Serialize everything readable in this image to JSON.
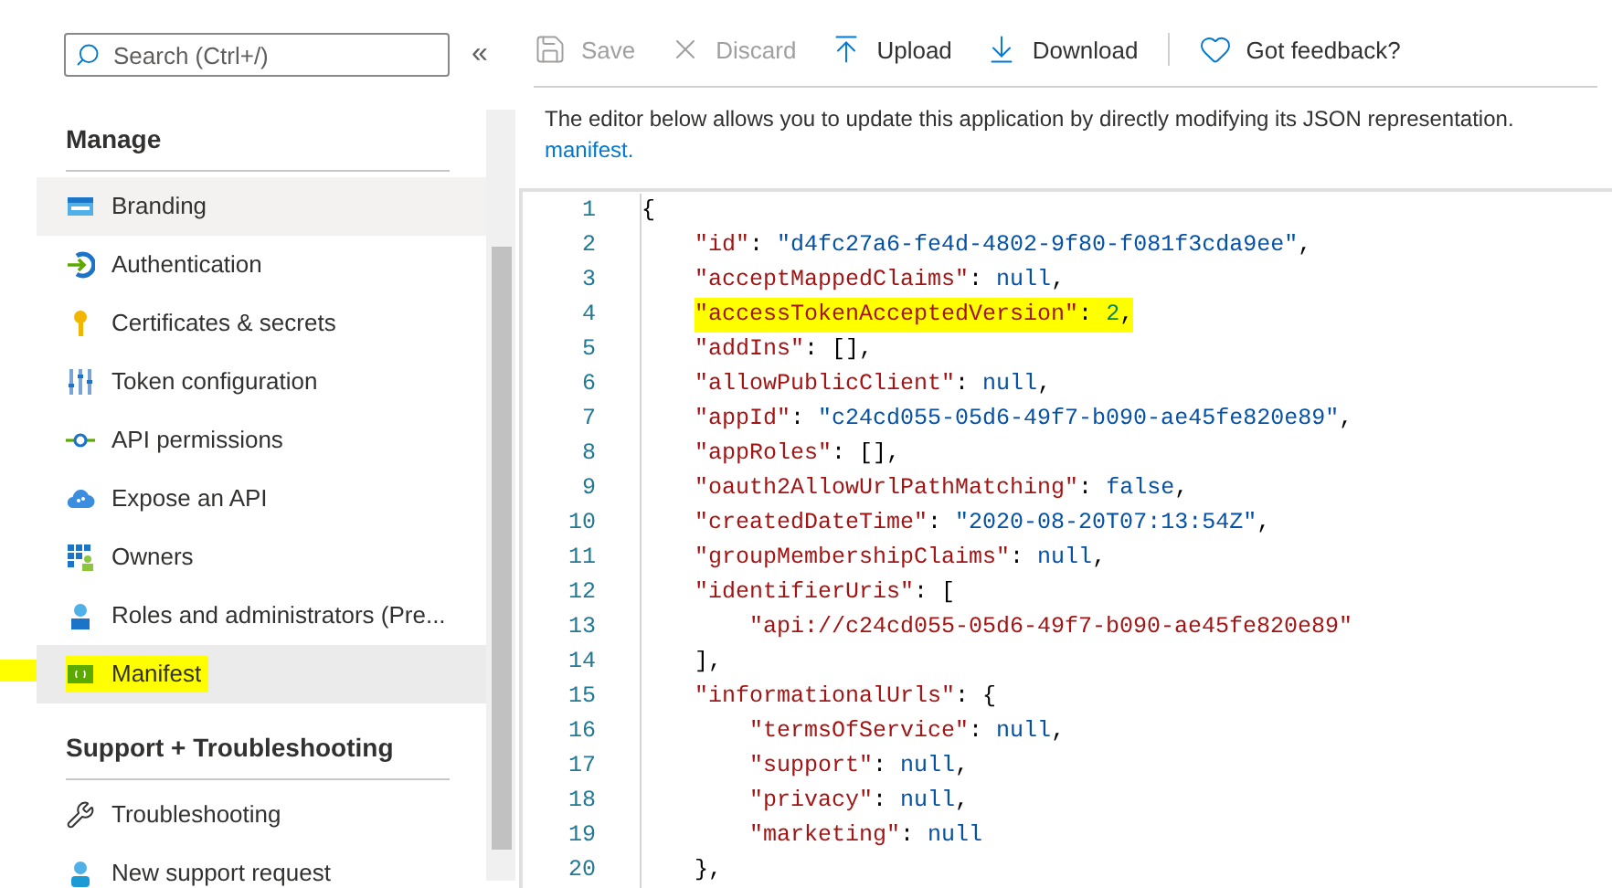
{
  "sidebar": {
    "search": {
      "placeholder": "Search (Ctrl+/)"
    },
    "collapse": "«",
    "sections": [
      {
        "title": "Manage",
        "items": [
          {
            "label": "Branding",
            "kind": "branding",
            "selected": false,
            "hovered": true,
            "highlighted": false
          },
          {
            "label": "Authentication",
            "kind": "auth",
            "selected": false,
            "hovered": false,
            "highlighted": false
          },
          {
            "label": "Certificates & secrets",
            "kind": "key",
            "selected": false,
            "hovered": false,
            "highlighted": false
          },
          {
            "label": "Token configuration",
            "kind": "sliders",
            "selected": false,
            "hovered": false,
            "highlighted": false
          },
          {
            "label": "API permissions",
            "kind": "api",
            "selected": false,
            "hovered": false,
            "highlighted": false
          },
          {
            "label": "Expose an API",
            "kind": "cloud",
            "selected": false,
            "hovered": false,
            "highlighted": false
          },
          {
            "label": "Owners",
            "kind": "owners",
            "selected": false,
            "hovered": false,
            "highlighted": false
          },
          {
            "label": "Roles and administrators (Pre...",
            "kind": "person",
            "selected": false,
            "hovered": false,
            "highlighted": false
          },
          {
            "label": "Manifest",
            "kind": "manifest",
            "selected": true,
            "hovered": false,
            "highlighted": true
          }
        ]
      },
      {
        "title": "Support + Troubleshooting",
        "items": [
          {
            "label": "Troubleshooting",
            "kind": "wrench",
            "selected": false,
            "hovered": false,
            "highlighted": false
          },
          {
            "label": "New support request",
            "kind": "support",
            "selected": false,
            "hovered": false,
            "highlighted": false
          }
        ]
      }
    ]
  },
  "toolbar": [
    {
      "label": "Save",
      "kind": "save",
      "disabled": true
    },
    {
      "label": "Discard",
      "kind": "discard",
      "disabled": true
    },
    {
      "label": "Upload",
      "kind": "upload",
      "disabled": false
    },
    {
      "label": "Download",
      "kind": "download",
      "disabled": false
    },
    {
      "label": "Got feedback?",
      "kind": "feedback",
      "disabled": false
    }
  ],
  "description": {
    "text": "The editor below allows you to update this application by directly modifying its JSON representation.",
    "link": "manifest."
  },
  "editor": {
    "lines": [
      {
        "number": "1",
        "highlighted": false,
        "tokens": [
          {
            "kind": "punct",
            "text": "{"
          }
        ],
        "children": [
          {
            "number": "2",
            "highlighted": false,
            "tokens": [
              {
                "kind": "key",
                "text": "\"id\""
              },
              {
                "kind": "punct",
                "text": ": "
              },
              {
                "kind": "string",
                "text": "\"d4fc27a6-fe4d-4802-9f80-f081f3cda9ee\""
              },
              {
                "kind": "punct",
                "text": ","
              }
            ]
          },
          {
            "number": "3",
            "highlighted": false,
            "tokens": [
              {
                "kind": "key",
                "text": "\"acceptMappedClaims\""
              },
              {
                "kind": "punct",
                "text": ": "
              },
              {
                "kind": "literal",
                "text": "null"
              },
              {
                "kind": "punct",
                "text": ","
              }
            ]
          },
          {
            "number": "4",
            "highlighted": true,
            "tokens": [
              {
                "kind": "key",
                "text": "\"accessTokenAcceptedVersion\""
              },
              {
                "kind": "punct",
                "text": ": "
              },
              {
                "kind": "number",
                "text": "2"
              },
              {
                "kind": "punct",
                "text": ","
              }
            ]
          },
          {
            "number": "5",
            "highlighted": false,
            "tokens": [
              {
                "kind": "key",
                "text": "\"addIns\""
              },
              {
                "kind": "punct",
                "text": ": [],"
              }
            ]
          },
          {
            "number": "6",
            "highlighted": false,
            "tokens": [
              {
                "kind": "key",
                "text": "\"allowPublicClient\""
              },
              {
                "kind": "punct",
                "text": ": "
              },
              {
                "kind": "literal",
                "text": "null"
              },
              {
                "kind": "punct",
                "text": ","
              }
            ]
          },
          {
            "number": "7",
            "highlighted": false,
            "tokens": [
              {
                "kind": "key",
                "text": "\"appId\""
              },
              {
                "kind": "punct",
                "text": ": "
              },
              {
                "kind": "string",
                "text": "\"c24cd055-05d6-49f7-b090-ae45fe820e89\""
              },
              {
                "kind": "punct",
                "text": ","
              }
            ]
          },
          {
            "number": "8",
            "highlighted": false,
            "tokens": [
              {
                "kind": "key",
                "text": "\"appRoles\""
              },
              {
                "kind": "punct",
                "text": ": [],"
              }
            ]
          },
          {
            "number": "9",
            "highlighted": false,
            "tokens": [
              {
                "kind": "key",
                "text": "\"oauth2AllowUrlPathMatching\""
              },
              {
                "kind": "punct",
                "text": ": "
              },
              {
                "kind": "literal",
                "text": "false"
              },
              {
                "kind": "punct",
                "text": ","
              }
            ]
          },
          {
            "number": "10",
            "highlighted": false,
            "tokens": [
              {
                "kind": "key",
                "text": "\"createdDateTime\""
              },
              {
                "kind": "punct",
                "text": ": "
              },
              {
                "kind": "string",
                "text": "\"2020-08-20T07:13:54Z\""
              },
              {
                "kind": "punct",
                "text": ","
              }
            ]
          },
          {
            "number": "11",
            "highlighted": false,
            "tokens": [
              {
                "kind": "key",
                "text": "\"groupMembershipClaims\""
              },
              {
                "kind": "punct",
                "text": ": "
              },
              {
                "kind": "literal",
                "text": "null"
              },
              {
                "kind": "punct",
                "text": ","
              }
            ]
          },
          {
            "number": "12",
            "highlighted": false,
            "tokens": [
              {
                "kind": "key",
                "text": "\"identifierUris\""
              },
              {
                "kind": "punct",
                "text": ": ["
              }
            ],
            "children": [
              {
                "number": "13",
                "highlighted": false,
                "tokens": [
                  {
                    "kind": "key",
                    "text": "\"api://c24cd055-05d6-49f7-b090-ae45fe820e89\""
                  }
                ]
              }
            ]
          },
          {
            "number": "14",
            "highlighted": false,
            "tokens": [
              {
                "kind": "punct",
                "text": "],"
              }
            ]
          },
          {
            "number": "15",
            "highlighted": false,
            "tokens": [
              {
                "kind": "key",
                "text": "\"informationalUrls\""
              },
              {
                "kind": "punct",
                "text": ": {"
              }
            ],
            "children": [
              {
                "number": "16",
                "highlighted": false,
                "tokens": [
                  {
                    "kind": "key",
                    "text": "\"termsOfService\""
                  },
                  {
                    "kind": "punct",
                    "text": ": "
                  },
                  {
                    "kind": "literal",
                    "text": "null"
                  },
                  {
                    "kind": "punct",
                    "text": ","
                  }
                ]
              },
              {
                "number": "17",
                "highlighted": false,
                "tokens": [
                  {
                    "kind": "key",
                    "text": "\"support\""
                  },
                  {
                    "kind": "punct",
                    "text": ": "
                  },
                  {
                    "kind": "literal",
                    "text": "null"
                  },
                  {
                    "kind": "punct",
                    "text": ","
                  }
                ]
              },
              {
                "number": "18",
                "highlighted": false,
                "tokens": [
                  {
                    "kind": "key",
                    "text": "\"privacy\""
                  },
                  {
                    "kind": "punct",
                    "text": ": "
                  },
                  {
                    "kind": "literal",
                    "text": "null"
                  },
                  {
                    "kind": "punct",
                    "text": ","
                  }
                ]
              },
              {
                "number": "19",
                "highlighted": false,
                "tokens": [
                  {
                    "kind": "key",
                    "text": "\"marketing\""
                  },
                  {
                    "kind": "punct",
                    "text": ": "
                  },
                  {
                    "kind": "literal",
                    "text": "null"
                  }
                ]
              }
            ]
          },
          {
            "number": "20",
            "highlighted": false,
            "tokens": [
              {
                "kind": "punct",
                "text": "},"
              }
            ]
          }
        ]
      }
    ]
  }
}
